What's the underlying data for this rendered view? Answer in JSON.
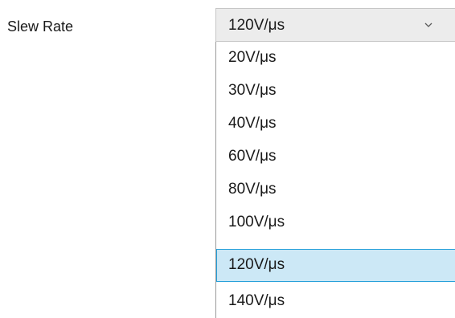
{
  "label": "Slew Rate",
  "combo": {
    "selected": "120V/μs",
    "chevron_icon": "chevron-down-icon"
  },
  "dropdown": {
    "options": [
      "20V/μs",
      "30V/μs",
      "40V/μs",
      "60V/μs",
      "80V/μs",
      "100V/μs",
      "120V/μs",
      "140V/μs"
    ],
    "selected_index": 6
  },
  "colors": {
    "highlight_background": "#cce8f6",
    "highlight_border": "#26a0da",
    "combo_background": "#ececec"
  }
}
